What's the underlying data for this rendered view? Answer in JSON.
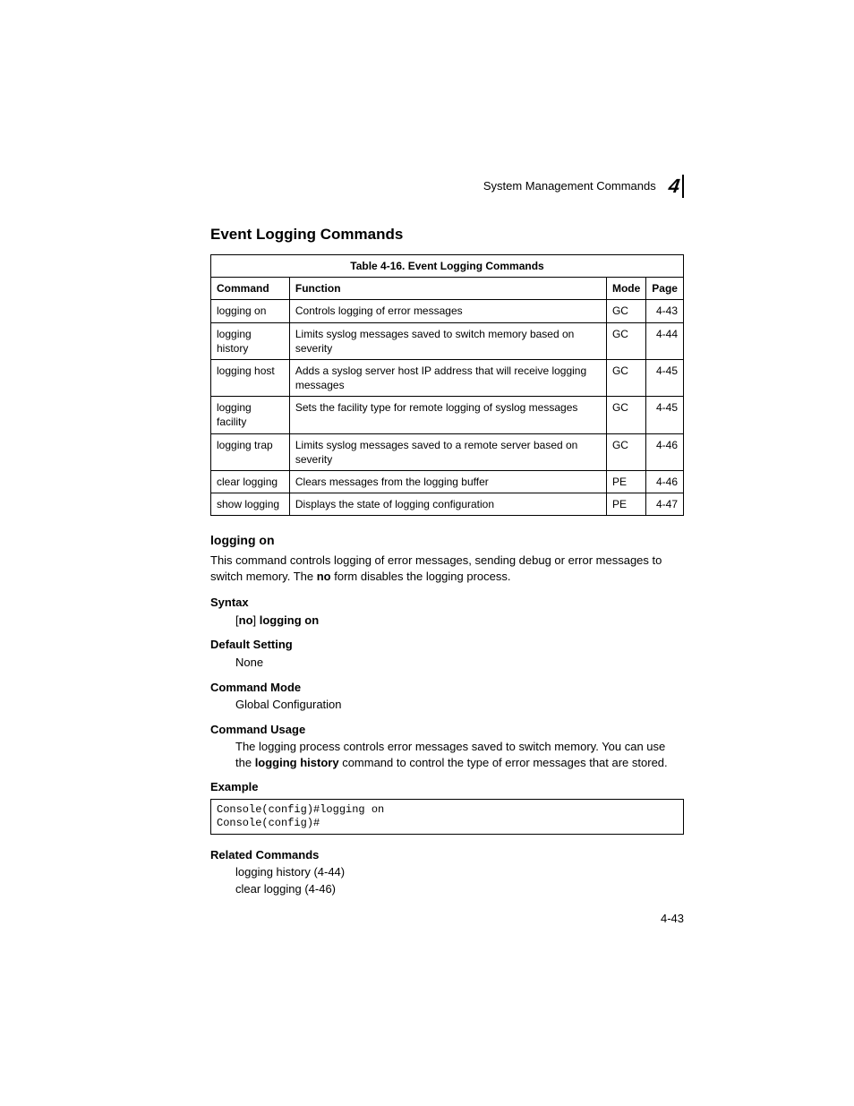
{
  "header": {
    "running": "System Management Commands",
    "chapter_number": "4"
  },
  "section_title": "Event Logging Commands",
  "table": {
    "caption": "Table 4-16.  Event Logging Commands",
    "headers": {
      "c1": "Command",
      "c2": "Function",
      "c3": "Mode",
      "c4": "Page"
    },
    "rows": [
      {
        "cmd": "logging on",
        "func": "Controls logging of error messages",
        "mode": "GC",
        "page": "4-43"
      },
      {
        "cmd": "logging history",
        "func": "Limits syslog messages saved to switch memory based on severity",
        "mode": "GC",
        "page": "4-44"
      },
      {
        "cmd": "logging host",
        "func": "Adds a syslog server host IP address that will receive logging messages",
        "mode": "GC",
        "page": "4-45"
      },
      {
        "cmd": "logging facility",
        "func": "Sets the facility type for remote logging of syslog messages",
        "mode": "GC",
        "page": "4-45"
      },
      {
        "cmd": "logging trap",
        "func": "Limits syslog messages saved to a remote server based on severity",
        "mode": "GC",
        "page": "4-46"
      },
      {
        "cmd": "clear logging",
        "func": "Clears messages from the logging buffer",
        "mode": "PE",
        "page": "4-46"
      },
      {
        "cmd": "show logging",
        "func": "Displays the state of logging configuration",
        "mode": "PE",
        "page": "4-47"
      }
    ]
  },
  "detail": {
    "name": "logging on",
    "desc_pre": "This command controls logging of error messages, sending debug or error messages to switch memory. The ",
    "desc_bold": "no",
    "desc_post": " form disables the logging process.",
    "syntax_label": "Syntax",
    "syntax_lb": "[",
    "syntax_no": "no",
    "syntax_rb": "] ",
    "syntax_cmd": "logging on",
    "default_label": "Default Setting",
    "default_value": "None",
    "mode_label": "Command Mode",
    "mode_value": "Global Configuration",
    "usage_label": "Command Usage",
    "usage_pre": "The logging process controls error messages saved to switch memory. You can use the ",
    "usage_bold": "logging history",
    "usage_post": " command to control the type of error messages that are stored.",
    "example_label": "Example",
    "example_code": "Console(config)#logging on\nConsole(config)#",
    "related_label": "Related Commands",
    "related_1": "logging history (4-44)",
    "related_2": "clear logging (4-46)"
  },
  "page_number": "4-43"
}
